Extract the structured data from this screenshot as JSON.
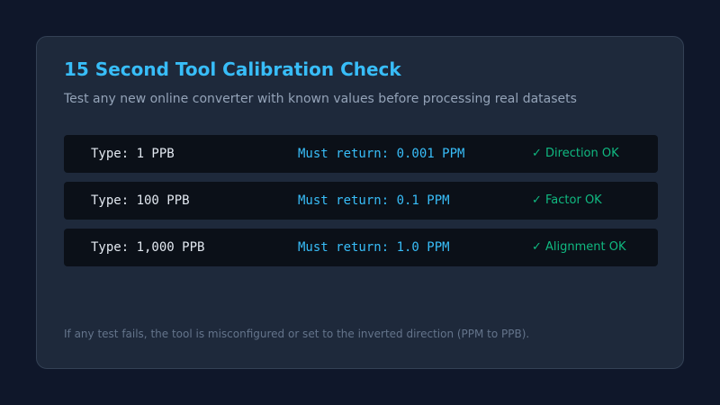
{
  "card": {
    "title": "15 Second Tool Calibration Check",
    "subtitle": "Test any new online converter with known values before processing real datasets",
    "footnote": "If any test fails, the tool is misconfigured or set to the inverted direction (PPM to PPB)."
  },
  "tests": [
    {
      "input": "Type: 1 PPB",
      "expected": "Must return: 0.001 PPM",
      "status": "✓ Direction OK"
    },
    {
      "input": "Type: 100 PPB",
      "expected": "Must return: 0.1 PPM",
      "status": "✓ Factor OK"
    },
    {
      "input": "Type: 1,000 PPB",
      "expected": "Must return: 1.0 PPM",
      "status": "✓ Alignment OK"
    }
  ],
  "colors": {
    "background": "#0f172a",
    "card": "#1e293b",
    "accent": "#38bdf8",
    "success": "#10b981"
  }
}
